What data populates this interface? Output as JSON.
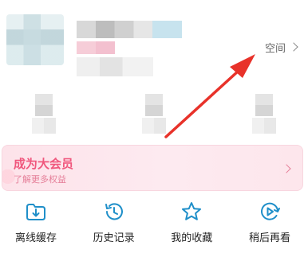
{
  "header": {
    "space_label": "空间"
  },
  "vip": {
    "title": "成为大会员",
    "subtitle": "了解更多权益"
  },
  "shortcuts": [
    {
      "label": "离线缓存",
      "icon": "download-folder-icon"
    },
    {
      "label": "历史记录",
      "icon": "history-clock-icon"
    },
    {
      "label": "我的收藏",
      "icon": "star-icon"
    },
    {
      "label": "稍后再看",
      "icon": "watch-later-icon"
    }
  ],
  "colors": {
    "accent_blue": "#1f8fc9",
    "vip_pink": "#f0577d",
    "annotation_red": "#e8322a"
  }
}
